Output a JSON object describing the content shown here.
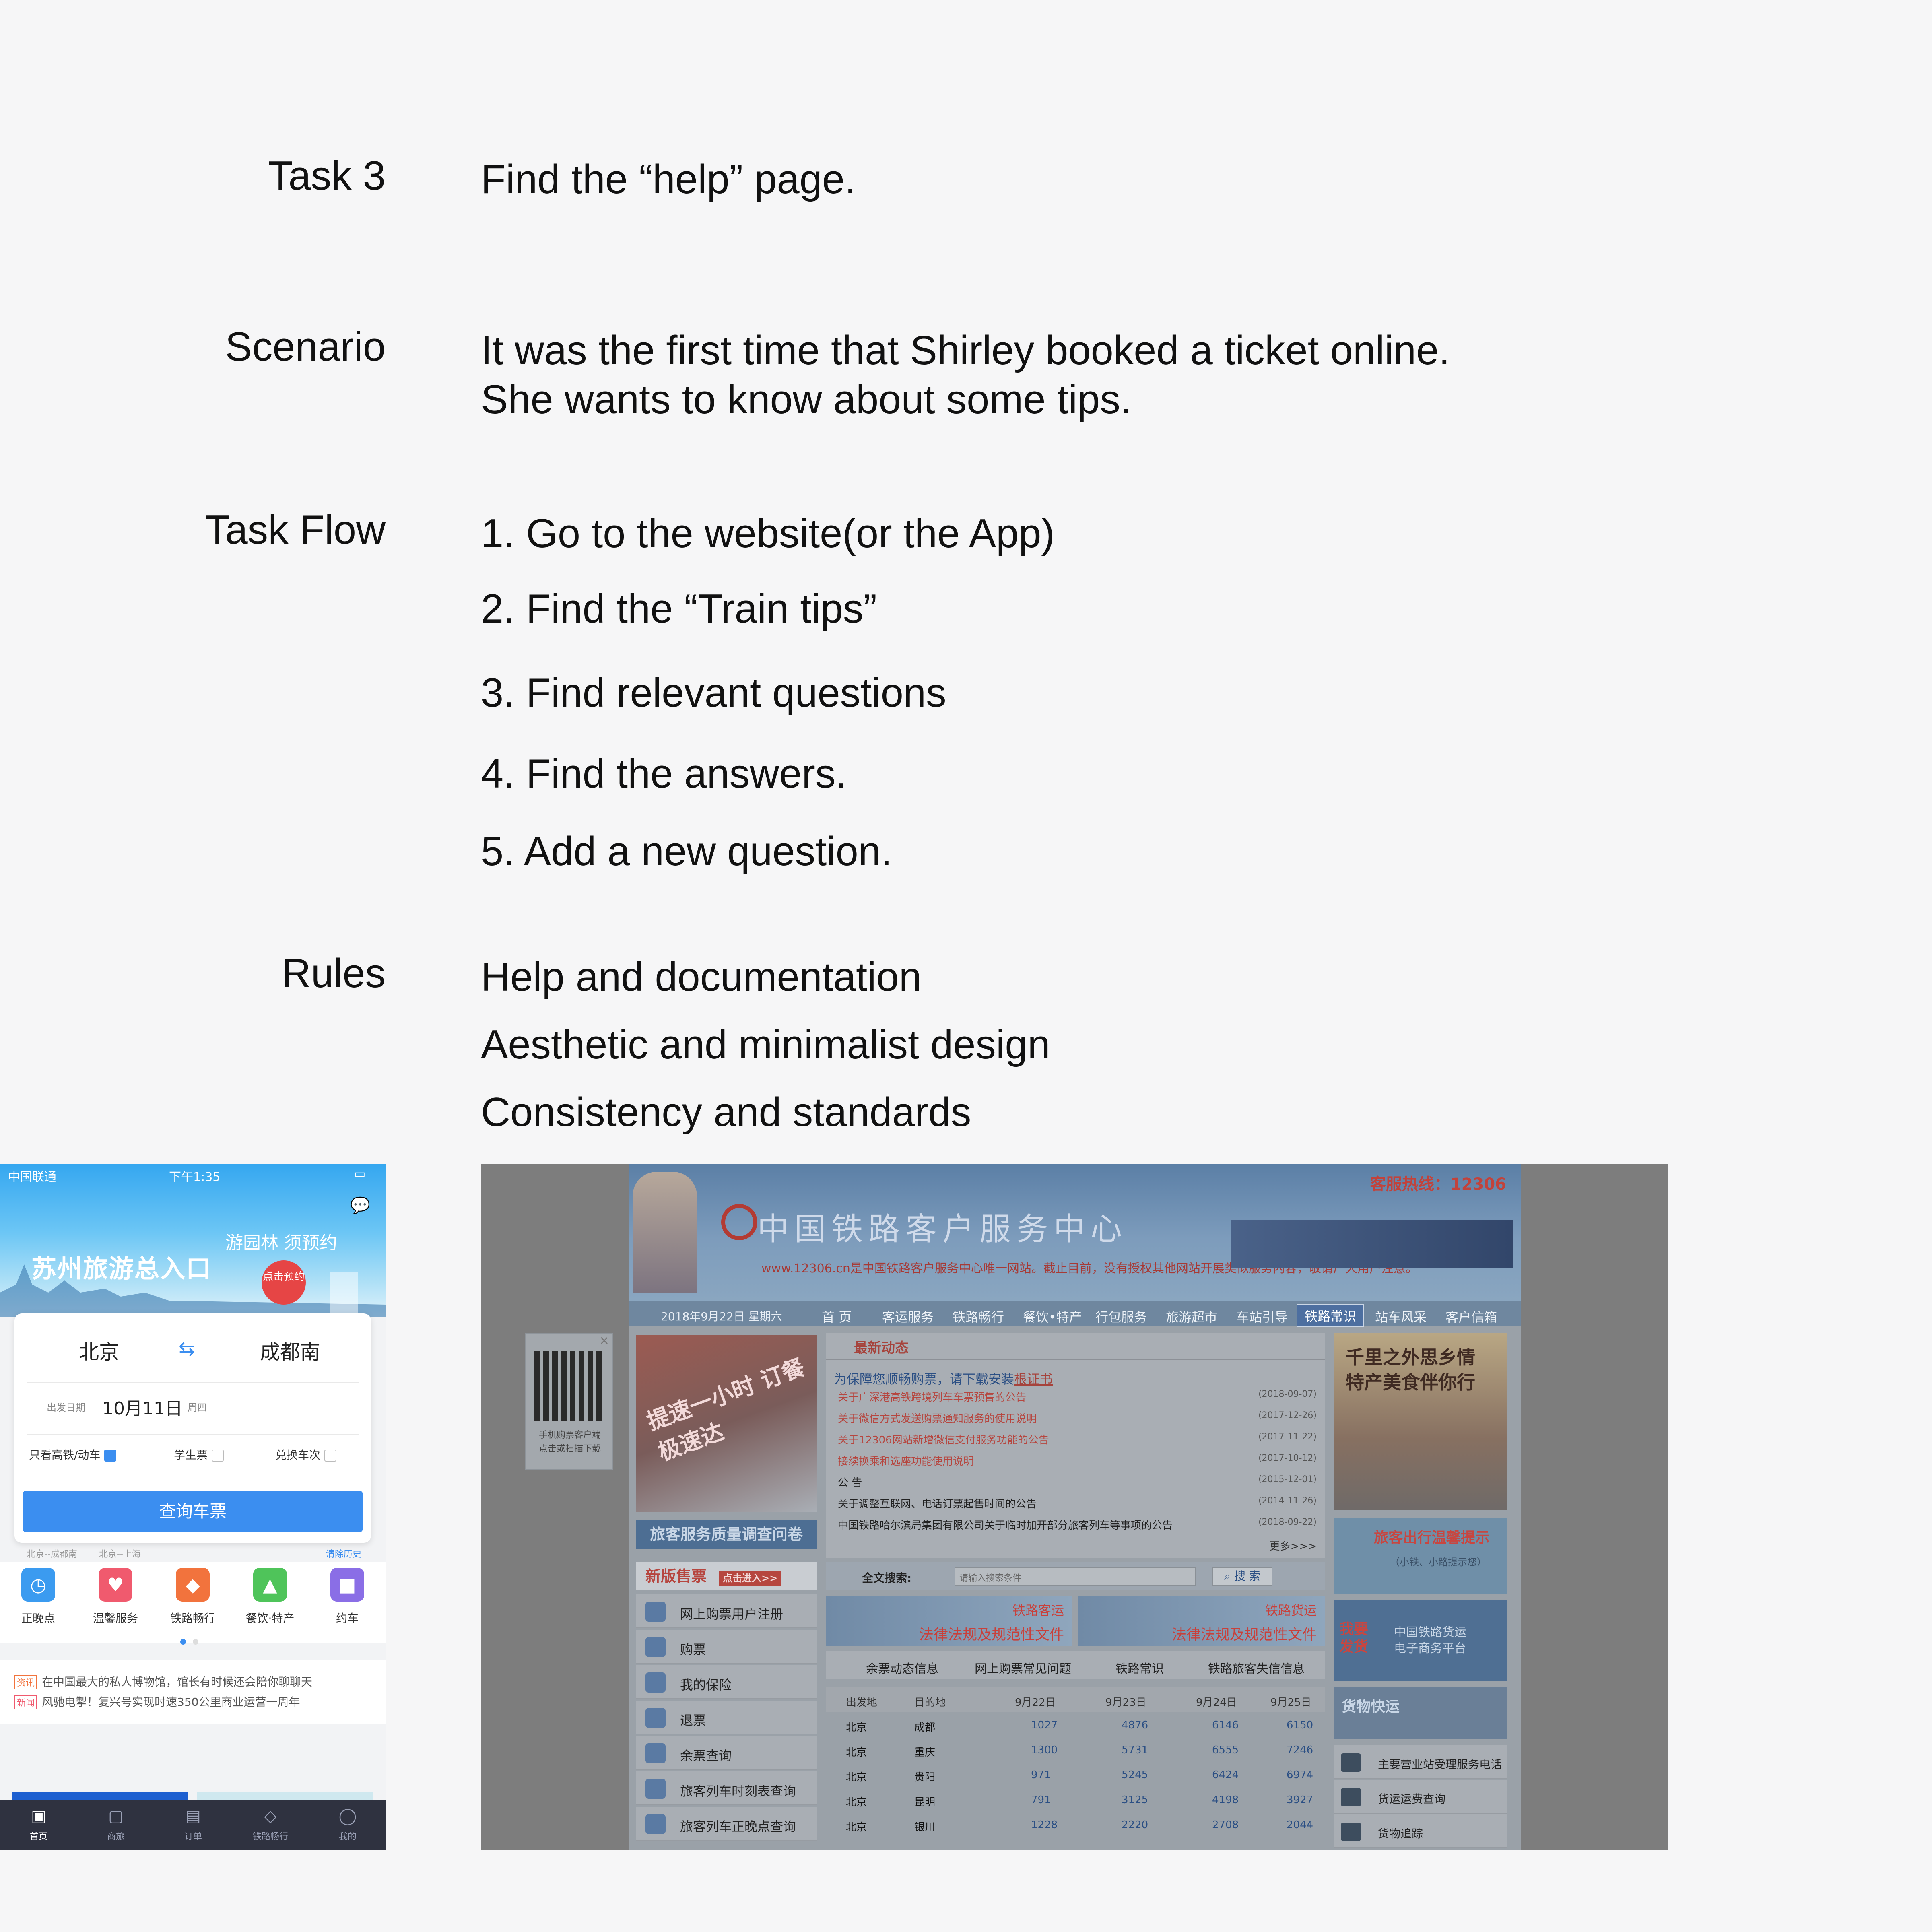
{
  "task": {
    "label": "Task 3",
    "text": "Find the “help” page."
  },
  "scenario": {
    "label": "Scenario",
    "lines": [
      "It was the first time that Shirley booked a ticket online.",
      "She wants to know about some tips."
    ]
  },
  "task_flow": {
    "label": "Task Flow",
    "steps": [
      "1. Go to the website(or the App)",
      "2. Find the “Train tips”",
      "3. Find relevant questions",
      "4. Find the answers.",
      "5. Add a new question."
    ]
  },
  "rules": {
    "label": "Rules",
    "items": [
      "Help and documentation",
      "Aesthetic and minimalist design",
      "Consistency and standards"
    ]
  },
  "app": {
    "status": {
      "carrier": "中国联通",
      "time": "下午1:35"
    },
    "banner": {
      "title": "苏州旅游总入口",
      "subtitle": "游园林 须预约",
      "badge": "点击预约"
    },
    "from_city": "北京",
    "to_city": "成都南",
    "swap_icon": "swap-arrows-icon",
    "date_label": "出发日期",
    "date": "10月11日",
    "weekday": "周四",
    "options": [
      "只看高铁/动车",
      "学生票",
      "兑换车次"
    ],
    "option_checked": [
      true,
      false,
      false
    ],
    "search_button": "查询车票",
    "history": [
      "北京--成都南",
      "北京--上海"
    ],
    "clear_history": "清除历史",
    "services": [
      {
        "name": "正晚点",
        "icon": "clock-icon",
        "color": "#3b9bf0"
      },
      {
        "name": "温馨服务",
        "icon": "heart-icon",
        "color": "#f05a6e"
      },
      {
        "name": "铁路畅行",
        "icon": "diamond-icon",
        "color": "#f2733d"
      },
      {
        "name": "餐饮·特产",
        "icon": "bell-icon",
        "color": "#4fc45a"
      },
      {
        "name": "约车",
        "icon": "car-icon",
        "color": "#8a6ee6"
      }
    ],
    "news": [
      {
        "tag": "资讯",
        "text": "在中国最大的私人博物馆，馆长有时候还会陪你聊聊天"
      },
      {
        "tag": "新闻",
        "text": "风驰电掣！复兴号实现时速350公里商业运营一周年"
      }
    ],
    "tabs": [
      "首页",
      "商旅",
      "订单",
      "铁路畅行",
      "我的"
    ]
  },
  "website": {
    "hotline": "客服热线：12306",
    "site_title": "中国铁路客户服务中心",
    "site_notice": "www.12306.cn是中国铁路客户服务中心唯一网站。截止目前，没有授权其他网站开展类似服务内容，敬请广大用户注意。",
    "date": "2018年9月22日  星期六",
    "nav": [
      "首 页",
      "客运服务",
      "铁路畅行",
      "餐饮•特产",
      "行包服务",
      "旅游超市",
      "车站引导",
      "铁路常识",
      "站车风采",
      "客户信箱"
    ],
    "nav_active": "铁路常识",
    "qr_text": "手机购票客户端\n点击或扫描下载",
    "promo_text": "提速一小时 订餐极速达",
    "survey_link": "旅客服务质量调查问卷",
    "news_heading": "最新动态",
    "news_first": "为保障您顺畅购票，请下载安装",
    "news_first_link": "根证书",
    "news_items": [
      {
        "text": "关于广深港高铁跨境列车车票预售的公告",
        "date": "(2018-09-07)",
        "red": true
      },
      {
        "text": "关于微信方式发送购票通知服务的使用说明",
        "date": "(2017-12-26)",
        "red": true
      },
      {
        "text": "关于12306网站新增微信支付服务功能的公告",
        "date": "(2017-11-22)",
        "red": true
      },
      {
        "text": "接续换乘和选座功能使用说明",
        "date": "(2017-10-12)",
        "red": true
      },
      {
        "text": "公 告",
        "date": "(2015-12-01)",
        "red": false
      },
      {
        "text": "关于调整互联网、电话订票起售时间的公告",
        "date": "(2014-11-26)",
        "red": false
      },
      {
        "text": "中国铁路哈尔滨局集团有限公司关于临时加开部分旅客列车等事项的公告",
        "date": "(2018-09-22)",
        "red": false
      }
    ],
    "more": "更多>>>",
    "sale_title": "新版售票",
    "sale_button": "点击进入>>",
    "side_menu": [
      "网上购票用户注册",
      "购票",
      "我的保险",
      "退票",
      "余票查询",
      "旅客列车时刻表查询",
      "旅客列车正晚点查询"
    ],
    "search_label": "全文搜索:",
    "search_placeholder": "请输入搜索条件",
    "search_button": "搜 索",
    "banners": [
      {
        "title": "铁路客运",
        "sub": "法律法规及规范性文件"
      },
      {
        "title": "铁路货运",
        "sub": "法律法规及规范性文件"
      }
    ],
    "info_tabs": [
      "余票动态信息",
      "网上购票常见问题",
      "铁路常识",
      "铁路旅客失信信息"
    ],
    "table_headers": [
      "出发地",
      "目的地",
      "9月22日",
      "9月23日",
      "9月24日",
      "9月25日"
    ],
    "table_rows": [
      [
        "北京",
        "成都",
        "1027",
        "4876",
        "6146",
        "6150"
      ],
      [
        "北京",
        "重庆",
        "1300",
        "5731",
        "6555",
        "7246"
      ],
      [
        "北京",
        "贵阳",
        "971",
        "5245",
        "6424",
        "6974"
      ],
      [
        "北京",
        "昆明",
        "791",
        "3125",
        "4198",
        "3927"
      ],
      [
        "北京",
        "银川",
        "1228",
        "2220",
        "2708",
        "2044"
      ]
    ],
    "right_promo": "千里之外思乡情\n特产美食伴你行",
    "right_tips": "旅客出行温馨提示",
    "right_tips_sub": "（小铁、小路提示您）",
    "freight_platform": "中国铁路货运\n电子商务平台",
    "freight_ship": "我要\n发货",
    "freight_express": "货物快运",
    "right_list": [
      "主要营业站受理服务电话",
      "货运运费查询",
      "货物追踪"
    ]
  }
}
